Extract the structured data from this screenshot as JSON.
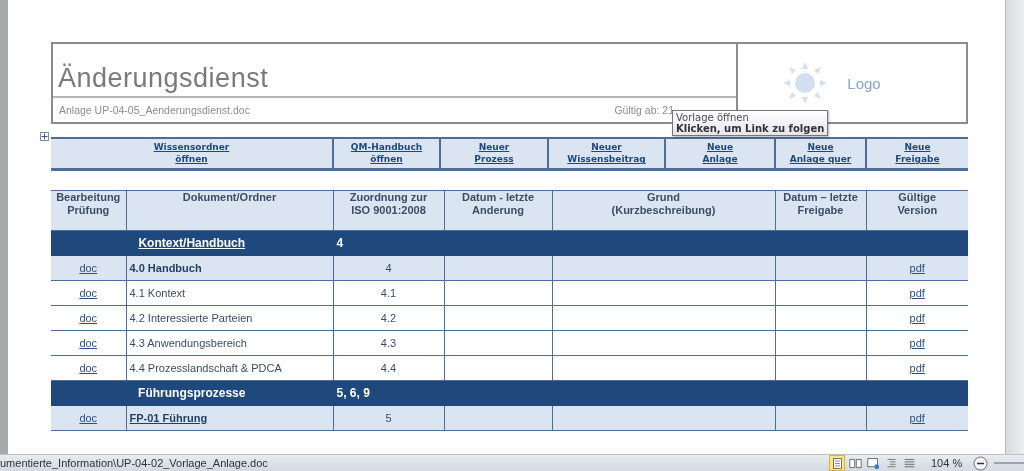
{
  "header": {
    "title": "Änderungsdienst",
    "file": "Anlage UP-04-05_Aenderungsdienst.doc",
    "valid_from": "Gültig ab: 21",
    "logo": "Logo"
  },
  "tooltip": {
    "line1": "Vorlage öffnen",
    "line2": "Klicken, um Link zu folgen"
  },
  "link_bar": [
    {
      "lines": [
        "Wissensordner",
        "öffnen"
      ]
    },
    {
      "lines": [
        "QM-Handbuch",
        "öffnen"
      ]
    },
    {
      "lines": [
        "Neuer",
        "Prozess"
      ]
    },
    {
      "lines": [
        "Neuer",
        "Wissensbeitrag"
      ]
    },
    {
      "lines": [
        "Neue",
        "Anlage"
      ]
    },
    {
      "lines": [
        "Neue",
        "Anlage quer"
      ]
    },
    {
      "lines": [
        "Neue",
        "Freigabe"
      ]
    }
  ],
  "table": {
    "columns": [
      {
        "lines": [
          "Bearbeitung",
          "Prüfung"
        ]
      },
      {
        "lines": [
          "Dokument/Ordner"
        ]
      },
      {
        "lines": [
          "Zuordnung zur",
          "ISO 9001:2008"
        ]
      },
      {
        "lines": [
          "Datum - letzte",
          "Anderung"
        ]
      },
      {
        "lines": [
          "Grund",
          "(Kurzbeschreibung)"
        ]
      },
      {
        "lines": [
          "Datum – letzte",
          "Freigabe"
        ]
      },
      {
        "lines": [
          "Gültige",
          "Version"
        ]
      }
    ],
    "rows": [
      {
        "kind": "section",
        "title": "Kontext/Handbuch",
        "iso": "4",
        "underlined": true
      },
      {
        "kind": "doc",
        "edit": "doc",
        "document": "4.0 Handbuch",
        "iso": "4",
        "version": "pdf",
        "bold": true,
        "underlined": false,
        "shaded": true
      },
      {
        "kind": "doc",
        "edit": "doc",
        "document": "4.1 Kontext",
        "iso": "4.1",
        "version": "pdf",
        "bold": false,
        "underlined": false,
        "shaded": false
      },
      {
        "kind": "doc",
        "edit": "doc",
        "document": "4.2 Interessierte Parteien",
        "iso": "4.2",
        "version": "pdf",
        "bold": false,
        "underlined": false,
        "shaded": false
      },
      {
        "kind": "doc",
        "edit": "doc",
        "document": "4.3 Anwendungsbereich",
        "iso": "4.3",
        "version": "pdf",
        "bold": false,
        "underlined": false,
        "shaded": false
      },
      {
        "kind": "doc",
        "edit": "doc",
        "document": "4.4 Prozesslandschaft & PDCA",
        "iso": "4.4",
        "version": "pdf",
        "bold": false,
        "underlined": false,
        "shaded": false
      },
      {
        "kind": "section",
        "title": "Führungsprozesse",
        "iso": "5, 6, 9",
        "underlined": false
      },
      {
        "kind": "doc",
        "edit": "doc",
        "document": "FP-01 Führung",
        "iso": "5",
        "version": "pdf",
        "bold": true,
        "underlined": true,
        "shaded": true
      }
    ]
  },
  "status_bar": {
    "path": "umentierte_Information\\UP-04-02_Vorlage_Anlage.doc",
    "views": [
      {
        "selected": true
      },
      {
        "selected": false
      },
      {
        "selected": false
      },
      {
        "selected": false
      },
      {
        "selected": false
      }
    ],
    "zoom": "104 %"
  }
}
